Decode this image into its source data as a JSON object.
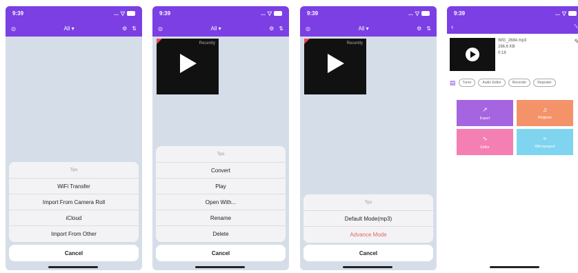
{
  "status": {
    "time": "9:39",
    "signal": "...",
    "wifi": "wifi-icon",
    "battery": "battery-icon"
  },
  "nav": {
    "title": "All",
    "caret": "▾"
  },
  "thumb": {
    "tag": "Recently"
  },
  "screen1": {
    "tip": "Tips",
    "options": [
      "WiFi Transfer",
      "Import From Camera Roll",
      "iCloud",
      "Import From Other"
    ],
    "cancel": "Cancel"
  },
  "screen2": {
    "tip": "Tips",
    "options": [
      "Convert",
      "Play",
      "Open With...",
      "Rename",
      "Delete"
    ],
    "cancel": "Cancel"
  },
  "screen3": {
    "tip": "Tips",
    "options": [
      "Default Mode(mp3)",
      "Advance Mode"
    ],
    "cancel": "Cancel"
  },
  "screen4": {
    "file": {
      "name": "IMG_2684.mp3",
      "size": "286.6 KB",
      "duration": "0:18"
    },
    "chips": [
      "Tuner",
      "Audio Editor",
      "Recorder",
      "Repeater"
    ],
    "tiles": [
      "Export",
      "Ringtone",
      "Editor",
      "Wifi transport"
    ]
  },
  "colors": {
    "accent": "#7b3fe4",
    "export": "#a564e0",
    "ringtone": "#f4936a",
    "editor": "#f47fb2",
    "wifi": "#7fd4f0",
    "danger": "#e06666"
  }
}
